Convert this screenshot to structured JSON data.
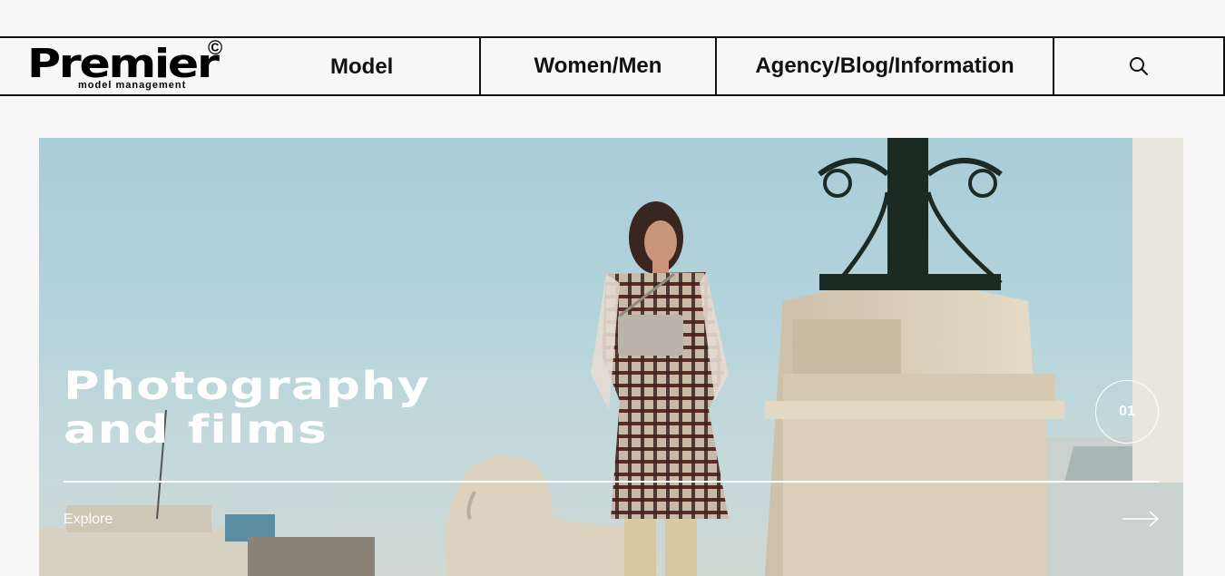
{
  "logo": {
    "wordmark": "Premier",
    "copyright": "©",
    "tagline": "model management"
  },
  "nav": {
    "items": [
      {
        "label": "Model"
      },
      {
        "label": "Women/Men"
      },
      {
        "label": "Agency/Blog/Information"
      }
    ],
    "search_icon": "search-icon"
  },
  "hero": {
    "title_line1": "Photography",
    "title_line2": "and films",
    "explore_label": "Explore",
    "slide_number": "01",
    "arrow_icon": "arrow-right-icon"
  }
}
